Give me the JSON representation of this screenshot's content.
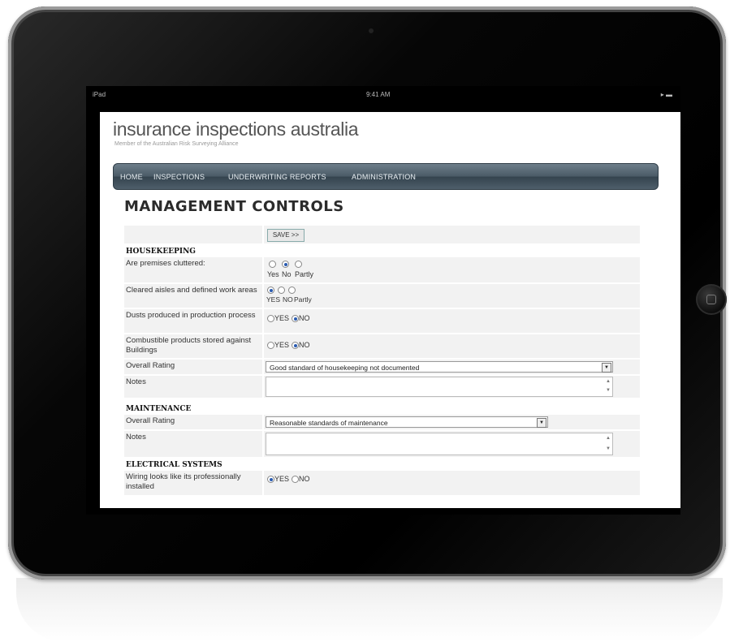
{
  "statusbar": {
    "device": "iPad",
    "time": "9:41 AM",
    "battery": "▸ ▬"
  },
  "site": {
    "title": "insurance inspections australia",
    "tagline": "Member of the Australian Risk Surveying Alliance"
  },
  "nav": {
    "items": [
      "HOME",
      "INSPECTIONS",
      "UNDERWRITING REPORTS",
      "ADMINISTRATION"
    ]
  },
  "page": {
    "title": "MANAGEMENT CONTROLS",
    "save_label": "SAVE >>"
  },
  "housekeeping": {
    "heading": "HOUSEKEEPING",
    "cluttered": {
      "label": "Are premises cluttered:",
      "options": [
        "Yes",
        "No",
        "Partly"
      ],
      "selected": "No"
    },
    "aisles": {
      "label": "Cleared aisles and defined work areas",
      "options": [
        "YES",
        "NO",
        "Partly"
      ],
      "selected": "YES"
    },
    "dusts": {
      "label": "Dusts produced in production process",
      "options": [
        "YES",
        "NO"
      ],
      "selected": "NO"
    },
    "combustible": {
      "label": "Combustible products stored against Buildings",
      "options": [
        "YES",
        "NO"
      ],
      "selected": "NO"
    },
    "rating": {
      "label": "Overall Rating",
      "value": "Good standard of housekeeping not documented"
    },
    "notes": {
      "label": "Notes"
    }
  },
  "maintenance": {
    "heading": "MAINTENANCE",
    "rating": {
      "label": "Overall Rating",
      "value": "Reasonable standards of maintenance"
    },
    "notes": {
      "label": "Notes"
    }
  },
  "electrical": {
    "heading": "ELECTRICAL SYSTEMS",
    "wiring": {
      "label": "Wiring looks like its professionally installed",
      "options": [
        "YES",
        "NO"
      ],
      "selected": "YES"
    }
  }
}
